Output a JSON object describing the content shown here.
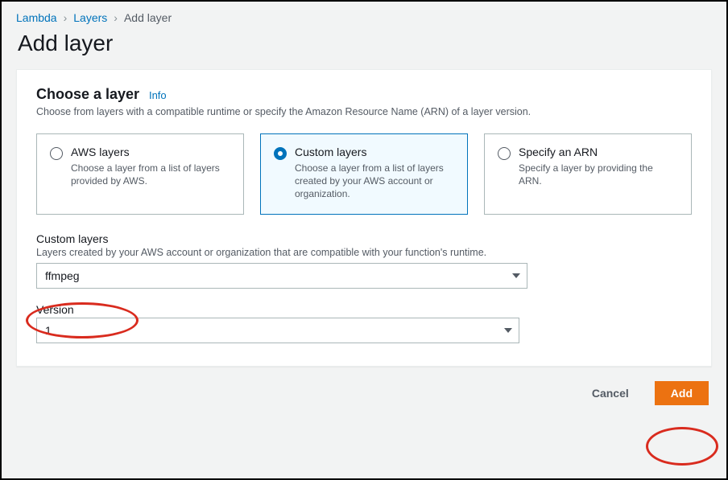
{
  "breadcrumb": {
    "items": [
      "Lambda",
      "Layers",
      "Add layer"
    ]
  },
  "page": {
    "title": "Add layer"
  },
  "section": {
    "title": "Choose a layer",
    "info": "Info",
    "desc": "Choose from layers with a compatible runtime or specify the Amazon Resource Name (ARN) of a layer version."
  },
  "options": {
    "aws": {
      "title": "AWS layers",
      "desc": "Choose a layer from a list of layers provided by AWS."
    },
    "custom": {
      "title": "Custom layers",
      "desc": "Choose a layer from a list of layers created by your AWS account or organization."
    },
    "arn": {
      "title": "Specify an ARN",
      "desc": "Specify a layer by providing the ARN."
    },
    "selected": "custom"
  },
  "fields": {
    "custom_layers": {
      "label": "Custom layers",
      "help": "Layers created by your AWS account or organization that are compatible with your function's runtime.",
      "value": "ffmpeg"
    },
    "version": {
      "label": "Version",
      "value": "1"
    }
  },
  "actions": {
    "cancel": "Cancel",
    "add": "Add"
  }
}
